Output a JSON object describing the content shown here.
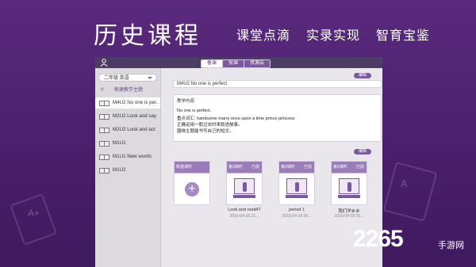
{
  "banner": {
    "title": "历史课程",
    "subtitles": [
      "课堂点滴",
      "实录实现",
      "智育宝鉴"
    ]
  },
  "decor": {
    "labels": [
      "A+",
      "A"
    ]
  },
  "app": {
    "tabs": [
      "备课",
      "授课",
      "资源云"
    ],
    "active_tab": 0,
    "grade_select": "二年级 英语",
    "new_theme_label": "新建教学主题",
    "lessons": [
      {
        "label": "M4U2 No one is per...",
        "active": true
      },
      {
        "label": "M2U2 Look and say",
        "active": false
      },
      {
        "label": "M2U2 Look and act",
        "active": false
      },
      {
        "label": "M1U1",
        "active": false
      },
      {
        "label": "M1U1 New words",
        "active": false
      },
      {
        "label": "M1U2",
        "active": false
      }
    ],
    "edit_label": "编辑",
    "lesson_title": "M4U2 No one is perfect",
    "content_label": "教学内容",
    "content_lines": [
      "No one is perfect.",
      "重点词汇: handsome    marry    once upon a time    prince    princess",
      "正确运用一般过去时来叙述故事。",
      "围绕主题能书写自己的短文。"
    ],
    "cards": [
      {
        "tag": "新建课时",
        "status": "",
        "title": "",
        "date": "",
        "type": "new"
      },
      {
        "tag": "第3课时",
        "status": "已授",
        "title": "Look and read47",
        "date": "2016-04-16 21...",
        "type": "lesson"
      },
      {
        "tag": "第2课时",
        "status": "已授",
        "title": "period 1",
        "date": "2016-04-19 09...",
        "type": "lesson"
      },
      {
        "tag": "第1课时",
        "status": "已授",
        "title": "我们学乡乡",
        "date": "2016-04-19 15...",
        "type": "lesson"
      }
    ]
  },
  "watermark": {
    "number": "2265",
    "suffix": "手游网"
  }
}
